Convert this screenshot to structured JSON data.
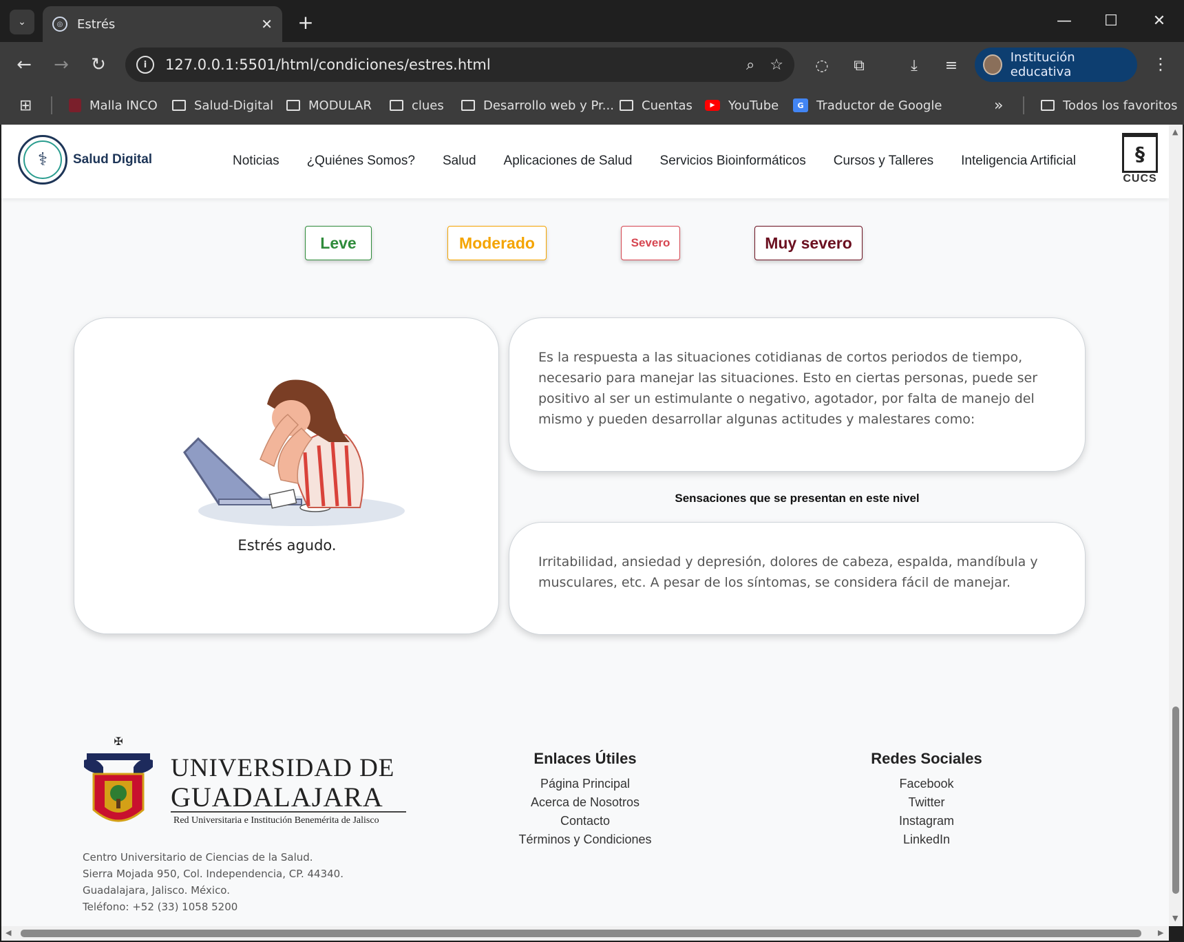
{
  "browser": {
    "tab_title": "Estrés",
    "url": "127.0.0.1:5501/html/condiciones/estres.html",
    "profile_label": "Institución educativa",
    "bookmarks": [
      "Malla INCO",
      "Salud-Digital",
      "MODULAR",
      "clues",
      "Desarrollo web y Pr...",
      "Cuentas",
      "YouTube",
      "Traductor de Google"
    ],
    "all_bookmarks": "Todos los favoritos"
  },
  "site": {
    "brand": "Salud Digital",
    "nav": [
      "Noticias",
      "¿Quiénes Somos?",
      "Salud",
      "Aplicaciones de Salud",
      "Servicios Bioinformáticos",
      "Cursos y Talleres",
      "Inteligencia Artificial"
    ],
    "cucs_label": "CUCS"
  },
  "levels": {
    "leve": "Leve",
    "moderado": "Moderado",
    "severo": "Severo",
    "muy_severo": "Muy severo",
    "colors": {
      "leve": "#2e8b3a",
      "moderado": "#f4a400",
      "severo": "#d64550",
      "muy_severo": "#6b1020"
    }
  },
  "content": {
    "image_caption": "Estrés agudo.",
    "description": "Es la respuesta a las situaciones cotidianas de cortos periodos de tiempo, necesario para manejar las situaciones. Esto en ciertas personas, puede ser positivo al ser un estimulante o negativo, agotador, por falta de manejo del mismo y pueden desarrollar algunas actitudes y malestares como:",
    "sensations_title": "Sensaciones que se presentan en este nivel",
    "sensations": "Irritabilidad, ansiedad y depresión, dolores de cabeza, espalda, mandíbula y musculares, etc. A pesar de los síntomas, se considera fácil de manejar."
  },
  "footer": {
    "university_line1": "UNIVERSIDAD DE",
    "university_line2": "GUADALAJARA",
    "university_sub": "Red Universitaria e Institución Benemérita de Jalisco",
    "address": [
      "Centro Universitario de Ciencias de la Salud.",
      "Sierra Mojada 950, Col. Independencia, CP. 44340.",
      "Guadalajara, Jalisco. México.",
      "Teléfono: +52 (33) 1058 5200"
    ],
    "links_title": "Enlaces Útiles",
    "links": [
      "Página Principal",
      "Acerca de Nosotros",
      "Contacto",
      "Términos y Condiciones"
    ],
    "social_title": "Redes Sociales",
    "social": [
      "Facebook",
      "Twitter",
      "Instagram",
      "LinkedIn"
    ]
  }
}
